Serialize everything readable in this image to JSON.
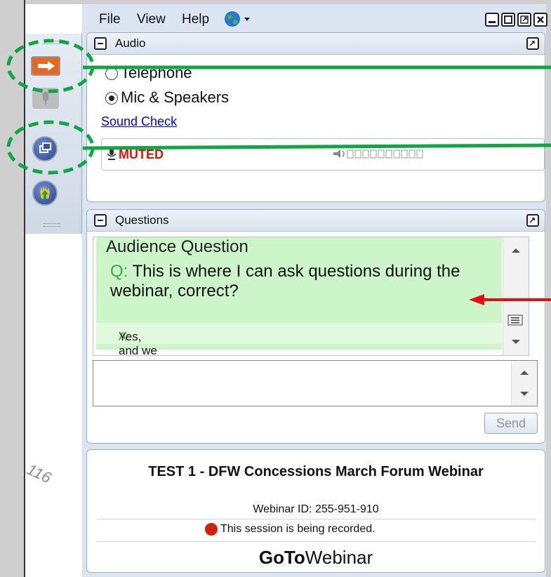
{
  "menu": {
    "file": "File",
    "view": "View",
    "help": "Help"
  },
  "audio": {
    "title": "Audio",
    "option_telephone": "Telephone",
    "option_mic": "Mic & Speakers",
    "sound_check": "Sound Check",
    "muted": "MUTED"
  },
  "questions": {
    "title": "Questions",
    "audience_header": "Audience Question",
    "q_prefix": "Q:",
    "question": "This is where I can ask questions during the webinar, correct?",
    "a_prefix": "A:",
    "answer": "Yes, and we  will respond with audio.",
    "send": "Send"
  },
  "session": {
    "title": "TEST 1 - DFW Concessions March Forum Webinar",
    "webinar_id": "Webinar ID: 255-951-910",
    "recording": "This session is being recorded."
  },
  "brand": {
    "bold": "GoTo",
    "light": "Webinar"
  },
  "watermark": "116",
  "colors": {
    "annotation_green": "#11a543",
    "annotation_red": "#e01111",
    "muted_red": "#d8140c",
    "question_bg": "#ccf5c9"
  }
}
